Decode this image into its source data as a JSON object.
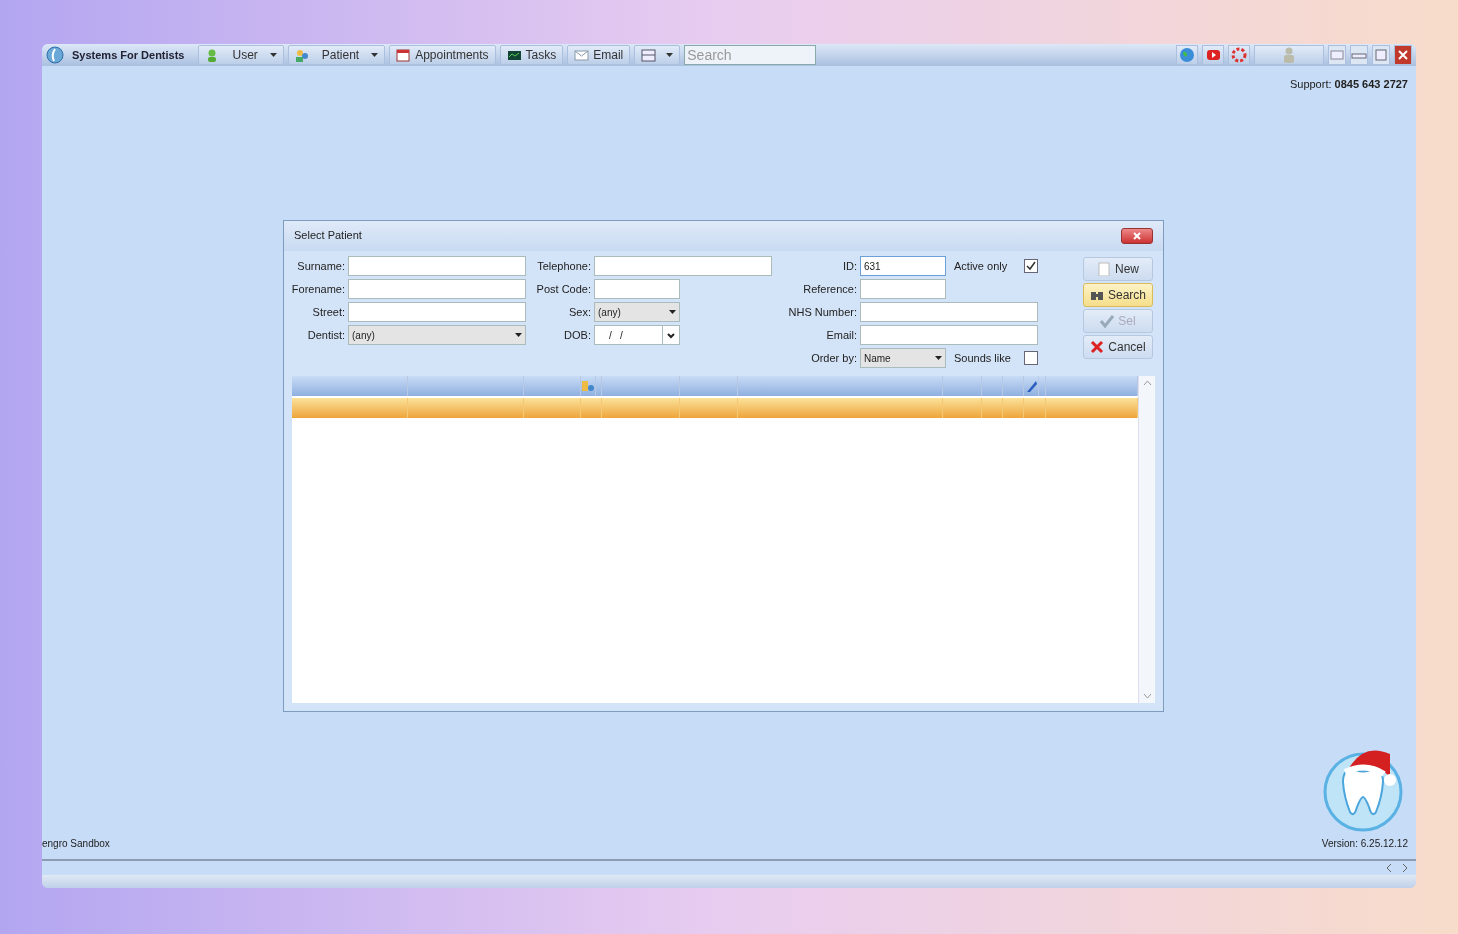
{
  "app": {
    "title": "Systems For Dentists",
    "search": {
      "placeholder": "Search"
    },
    "support_label": "Support:",
    "support_number": "0845 643 2727",
    "practice": "engro Sandbox",
    "version": "Version: 6.25.12.12"
  },
  "menu": [
    {
      "label": "User",
      "kind": "dropdown"
    },
    {
      "label": "Patient",
      "kind": "dropdown"
    },
    {
      "label": "Appointments",
      "kind": "button"
    },
    {
      "label": "Tasks",
      "kind": "button"
    },
    {
      "label": "Email",
      "kind": "button"
    },
    {
      "kind": "icon-dropdown"
    }
  ],
  "dialog": {
    "title": "Select Patient",
    "columns": [
      [
        {
          "label": "Surname:",
          "kind": "text"
        },
        {
          "label": "Forename:",
          "kind": "text"
        },
        {
          "label": "Street:",
          "kind": "text"
        },
        {
          "label": "Dentist:",
          "kind": "select",
          "value": "(any)"
        }
      ],
      [
        {
          "label": "Telephone:",
          "kind": "text"
        },
        {
          "label": "Post Code:",
          "kind": "text"
        },
        {
          "label": "Sex:",
          "kind": "select",
          "value": "(any)"
        },
        {
          "label": "DOB:",
          "kind": "date",
          "value": "/   /"
        }
      ],
      [
        {
          "label": "ID:",
          "kind": "text",
          "value": "631",
          "focused": true,
          "option": {
            "label": "Active only",
            "checked": true
          }
        },
        {
          "label": "Reference:",
          "kind": "text",
          "focused": false
        },
        {
          "label": "NHS Number:",
          "kind": "text",
          "focused": false
        },
        {
          "label": "Email:",
          "kind": "text",
          "focused": false
        },
        {
          "label": "Order by:",
          "kind": "select",
          "value": "Name",
          "option": {
            "label": "Sounds like",
            "checked": false
          }
        }
      ]
    ],
    "buttons": [
      {
        "label": "New",
        "kind": "new",
        "disabled": false,
        "hover": false
      },
      {
        "label": "Search",
        "kind": "search",
        "disabled": false,
        "hover": true
      },
      {
        "label": "Sel",
        "kind": "select",
        "disabled": true,
        "hover": false
      },
      {
        "label": "Cancel",
        "kind": "cancel",
        "disabled": false,
        "hover": false
      }
    ]
  }
}
